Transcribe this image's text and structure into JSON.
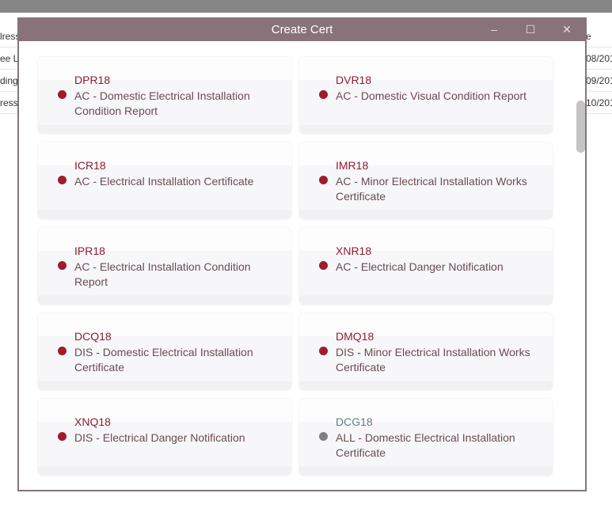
{
  "background": {
    "left_rows": [
      "lress",
      "ee L",
      "ding",
      "ress"
    ],
    "right_rows": [
      "e",
      "08/201",
      "09/201",
      "10/201"
    ]
  },
  "dialog": {
    "title": "Create Cert",
    "minimize": "–",
    "maximize": "☐",
    "close": "✕"
  },
  "colors": {
    "active": "#a01b2c",
    "inactive": "#808080",
    "titlebar": "#877379"
  },
  "certs": [
    {
      "code": "DPR18",
      "desc": "AC - Domestic Electrical Installation Condition Report",
      "status": "active"
    },
    {
      "code": "DVR18",
      "desc": "AC - Domestic Visual Condition Report",
      "status": "active"
    },
    {
      "code": "ICR18",
      "desc": "AC - Electrical Installation Certificate",
      "status": "active"
    },
    {
      "code": "IMR18",
      "desc": "AC - Minor Electrical Installation Works Certificate",
      "status": "active"
    },
    {
      "code": "IPR18",
      "desc": "AC - Electrical Installation Condition Report",
      "status": "active"
    },
    {
      "code": "XNR18",
      "desc": "AC - Electrical Danger Notification",
      "status": "active"
    },
    {
      "code": "DCQ18",
      "desc": "DIS - Domestic Electrical Installation Certificate",
      "status": "active"
    },
    {
      "code": "DMQ18",
      "desc": "DIS - Minor Electrical Installation Works Certificate",
      "status": "active"
    },
    {
      "code": "XNQ18",
      "desc": "DIS - Electrical Danger Notification",
      "status": "active"
    },
    {
      "code": "DCG18",
      "desc": "ALL - Domestic Electrical Installation Certificate",
      "status": "inactive"
    }
  ]
}
